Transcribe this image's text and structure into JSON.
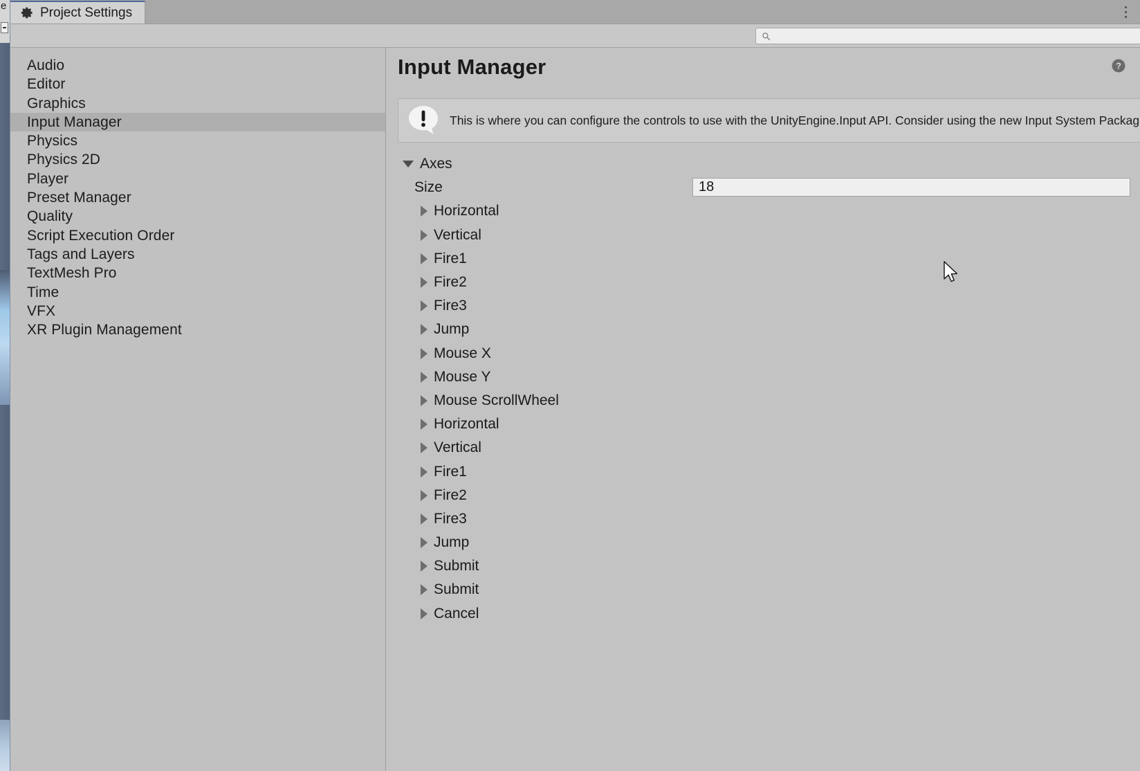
{
  "window": {
    "tab_label": "Project Settings",
    "tab_icon": "gear-icon",
    "menu_icon": "kebab-menu-icon",
    "background_fragment_text": "e"
  },
  "search": {
    "value": "",
    "placeholder": "",
    "icon": "search-icon"
  },
  "sidebar": {
    "items": [
      {
        "label": "Audio",
        "selected": false
      },
      {
        "label": "Editor",
        "selected": false
      },
      {
        "label": "Graphics",
        "selected": false
      },
      {
        "label": "Input Manager",
        "selected": true
      },
      {
        "label": "Physics",
        "selected": false
      },
      {
        "label": "Physics 2D",
        "selected": false
      },
      {
        "label": "Player",
        "selected": false
      },
      {
        "label": "Preset Manager",
        "selected": false
      },
      {
        "label": "Quality",
        "selected": false
      },
      {
        "label": "Script Execution Order",
        "selected": false
      },
      {
        "label": "Tags and Layers",
        "selected": false
      },
      {
        "label": "TextMesh Pro",
        "selected": false
      },
      {
        "label": "Time",
        "selected": false
      },
      {
        "label": "VFX",
        "selected": false
      },
      {
        "label": "XR Plugin Management",
        "selected": false
      }
    ]
  },
  "detail": {
    "title": "Input Manager",
    "help_icon": "help-circle-icon",
    "info": {
      "icon": "info-speech-bubble-icon",
      "text": "This is where you can configure the controls to use with the UnityEngine.Input API. Consider using the new Input System Package instead."
    },
    "axes_group": {
      "label": "Axes",
      "expanded": true,
      "size_label": "Size",
      "size_value": "18",
      "items": [
        {
          "label": "Horizontal",
          "expanded": false
        },
        {
          "label": "Vertical",
          "expanded": false
        },
        {
          "label": "Fire1",
          "expanded": false
        },
        {
          "label": "Fire2",
          "expanded": false
        },
        {
          "label": "Fire3",
          "expanded": false
        },
        {
          "label": "Jump",
          "expanded": false
        },
        {
          "label": "Mouse X",
          "expanded": false
        },
        {
          "label": "Mouse Y",
          "expanded": false
        },
        {
          "label": "Mouse ScrollWheel",
          "expanded": false
        },
        {
          "label": "Horizontal",
          "expanded": false
        },
        {
          "label": "Vertical",
          "expanded": false
        },
        {
          "label": "Fire1",
          "expanded": false
        },
        {
          "label": "Fire2",
          "expanded": false
        },
        {
          "label": "Fire3",
          "expanded": false
        },
        {
          "label": "Jump",
          "expanded": false
        },
        {
          "label": "Submit",
          "expanded": false
        },
        {
          "label": "Submit",
          "expanded": false
        },
        {
          "label": "Cancel",
          "expanded": false
        }
      ]
    }
  },
  "colors": {
    "panel": "#c3c3c3",
    "sidebar": "#c1c1c1",
    "selection": "#afafaf",
    "tab_active": "#d2d2d2",
    "tab_accent": "#4d6a99",
    "field": "#efefef",
    "text": "#1a1a1a"
  }
}
